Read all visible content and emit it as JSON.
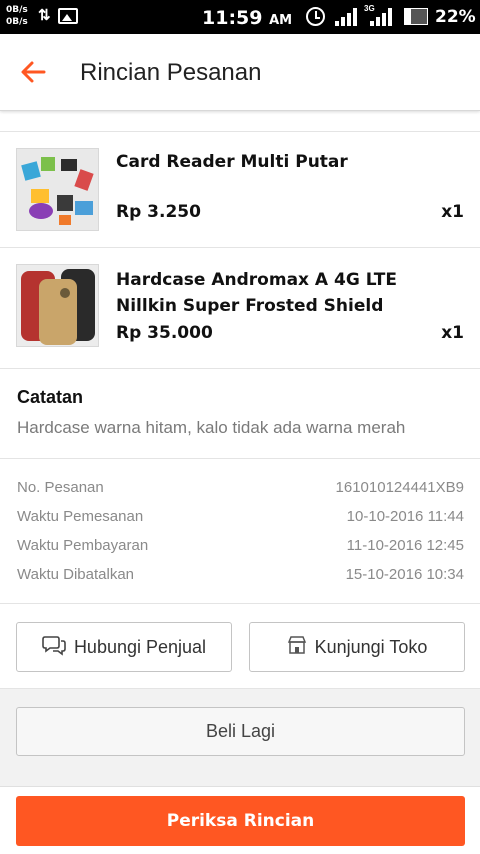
{
  "status_bar": {
    "net_up": "0B/s",
    "net_down": "0B/s",
    "time": "11:59",
    "ampm": "AM",
    "network": "3G",
    "battery": "22%"
  },
  "header": {
    "back_icon": "arrow-left-icon",
    "title": "Rincian Pesanan"
  },
  "items": [
    {
      "name": "Card Reader Multi Putar",
      "price": "Rp 3.250",
      "qty": "x1"
    },
    {
      "name": "Hardcase Andromax A 4G LTE Nillkin Super Frosted Shield",
      "price": "Rp 35.000",
      "qty": "x1"
    }
  ],
  "note": {
    "title": "Catatan",
    "text": "Hardcase warna hitam, kalo tidak ada warna merah"
  },
  "details": [
    {
      "label": "No. Pesanan",
      "value": "161010124441XB9"
    },
    {
      "label": "Waktu Pemesanan",
      "value": "10-10-2016 11:44"
    },
    {
      "label": "Waktu Pembayaran",
      "value": "11-10-2016 12:45"
    },
    {
      "label": "Waktu Dibatalkan",
      "value": "15-10-2016 10:34"
    }
  ],
  "actions": {
    "contact_seller": "Hubungi Penjual",
    "contact_icon": "chat-icon",
    "visit_shop": "Kunjungi Toko",
    "shop_icon": "store-icon",
    "buy_again": "Beli Lagi",
    "check_details": "Periksa Rincian"
  },
  "colors": {
    "accent": "#ff5722",
    "status_bar": "#000000"
  }
}
